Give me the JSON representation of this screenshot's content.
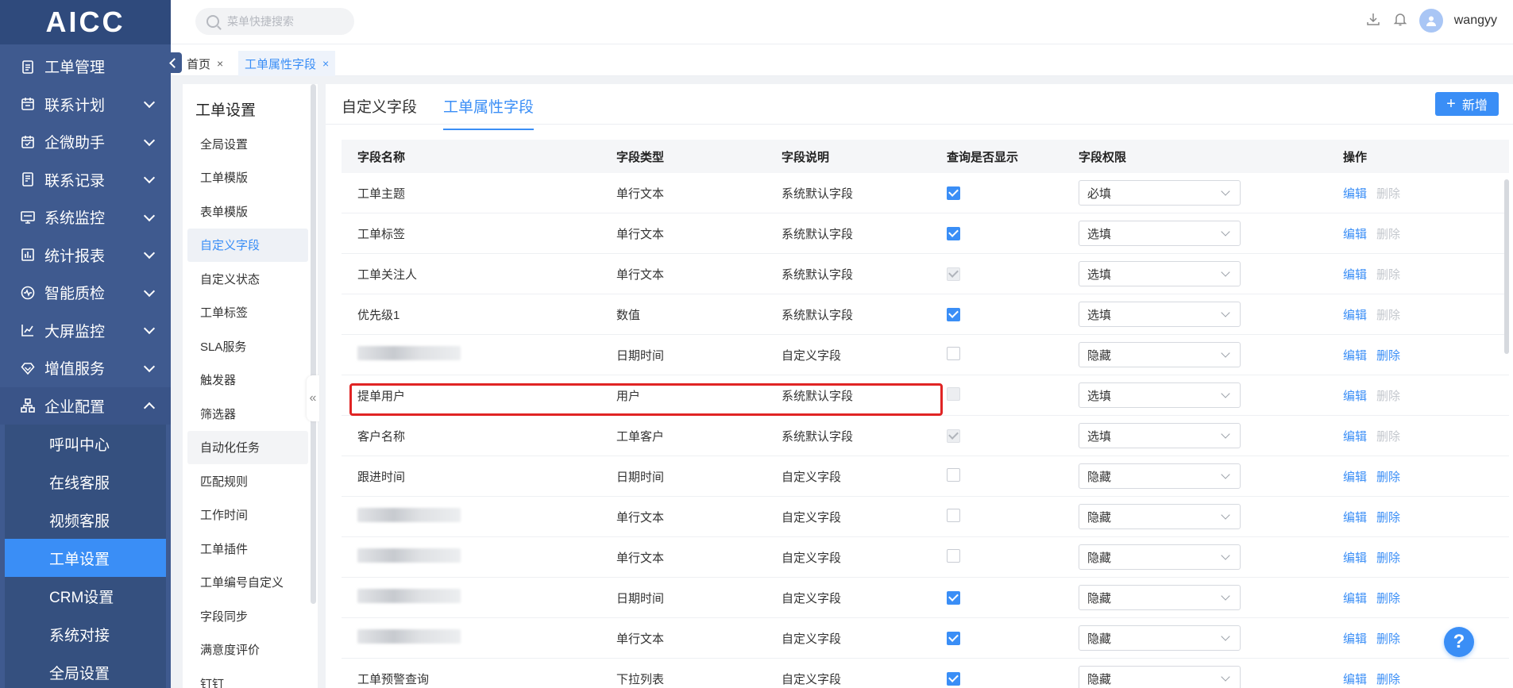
{
  "app": {
    "logo": "AICC"
  },
  "sidebar": {
    "items": [
      {
        "label": "工单管理",
        "icon": "clipboard-icon",
        "expandable": false
      },
      {
        "label": "联系计划",
        "icon": "calendar-icon",
        "expandable": true
      },
      {
        "label": "企微助手",
        "icon": "calendar-check-icon",
        "expandable": true
      },
      {
        "label": "联系记录",
        "icon": "document-icon",
        "expandable": true
      },
      {
        "label": "系统监控",
        "icon": "monitor-icon",
        "expandable": true
      },
      {
        "label": "统计报表",
        "icon": "bar-chart-icon",
        "expandable": true
      },
      {
        "label": "智能质检",
        "icon": "quality-icon",
        "expandable": true
      },
      {
        "label": "大屏监控",
        "icon": "trend-chart-icon",
        "expandable": true
      },
      {
        "label": "增值服务",
        "icon": "diamond-icon",
        "expandable": true
      },
      {
        "label": "企业配置",
        "icon": "org-tree-icon",
        "expandable": true,
        "expanded": true
      }
    ],
    "sub_items": [
      "呼叫中心",
      "在线客服",
      "视频客服",
      "工单设置",
      "CRM设置",
      "系统对接",
      "全局设置"
    ],
    "active_sub": "工单设置"
  },
  "topbar": {
    "search_placeholder": "菜单快捷搜索",
    "username": "wangyy"
  },
  "page_tabs": [
    {
      "label": "首页",
      "close": "×"
    },
    {
      "label": "工单属性字段",
      "close": "×"
    }
  ],
  "left_nav": {
    "title": "工单设置",
    "items": [
      "全局设置",
      "工单模版",
      "表单模版",
      "自定义字段",
      "自定义状态",
      "工单标签",
      "SLA服务",
      "触发器",
      "筛选器",
      "自动化任务",
      "匹配规则",
      "工作时间",
      "工单插件",
      "工单编号自定义",
      "字段同步",
      "满意度评价",
      "钉钉"
    ],
    "active": "自定义字段",
    "hover": "自动化任务",
    "collapse_glyph": "«"
  },
  "main": {
    "tabs": [
      "自定义字段",
      "工单属性字段"
    ],
    "active_tab": "工单属性字段",
    "add_button": "新增",
    "add_icon": "+",
    "columns": [
      "字段名称",
      "字段类型",
      "字段说明",
      "查询是否显示",
      "字段权限",
      "操作"
    ],
    "edit_label": "编辑",
    "delete_label": "删除",
    "rows": [
      {
        "name": "工单主题",
        "type": "单行文本",
        "desc": "系统默认字段",
        "show": "on",
        "perm": "必填",
        "deletable": false
      },
      {
        "name": "工单标签",
        "type": "单行文本",
        "desc": "系统默认字段",
        "show": "on",
        "perm": "选填",
        "deletable": false
      },
      {
        "name": "工单关注人",
        "type": "单行文本",
        "desc": "系统默认字段",
        "show": "dis-on",
        "perm": "选填",
        "deletable": false
      },
      {
        "name": "优先级1",
        "type": "数值",
        "desc": "系统默认字段",
        "show": "on",
        "perm": "选填",
        "deletable": false
      },
      {
        "name": "",
        "blurred": true,
        "type": "日期时间",
        "desc": "自定义字段",
        "show": "off",
        "perm": "隐藏",
        "deletable": true
      },
      {
        "name": "提单用户",
        "type": "用户",
        "desc": "系统默认字段",
        "show": "dis",
        "perm": "选填",
        "deletable": false
      },
      {
        "name": "客户名称",
        "type": "工单客户",
        "desc": "系统默认字段",
        "show": "dis-on",
        "perm": "选填",
        "deletable": false
      },
      {
        "name": "跟进时间",
        "type": "日期时间",
        "desc": "自定义字段",
        "show": "off",
        "perm": "隐藏",
        "deletable": true
      },
      {
        "name": "",
        "blurred": true,
        "type": "单行文本",
        "desc": "自定义字段",
        "show": "off",
        "perm": "隐藏",
        "deletable": true
      },
      {
        "name": "",
        "blurred": true,
        "type": "单行文本",
        "desc": "自定义字段",
        "show": "off",
        "perm": "隐藏",
        "deletable": true
      },
      {
        "name": "",
        "blurred": true,
        "type": "日期时间",
        "desc": "自定义字段",
        "show": "on",
        "perm": "隐藏",
        "deletable": true
      },
      {
        "name": "",
        "blurred": true,
        "type": "单行文本",
        "desc": "自定义字段",
        "show": "on",
        "perm": "隐藏",
        "deletable": true
      },
      {
        "name": "工单预警查询",
        "type": "下拉列表",
        "desc": "自定义字段",
        "show": "on",
        "perm": "隐藏",
        "deletable": true
      }
    ]
  },
  "help": {
    "label": "?"
  },
  "colors": {
    "sidebar": "#3f5a8f",
    "accent": "#3a8ef6",
    "highlight": "#e02424"
  }
}
